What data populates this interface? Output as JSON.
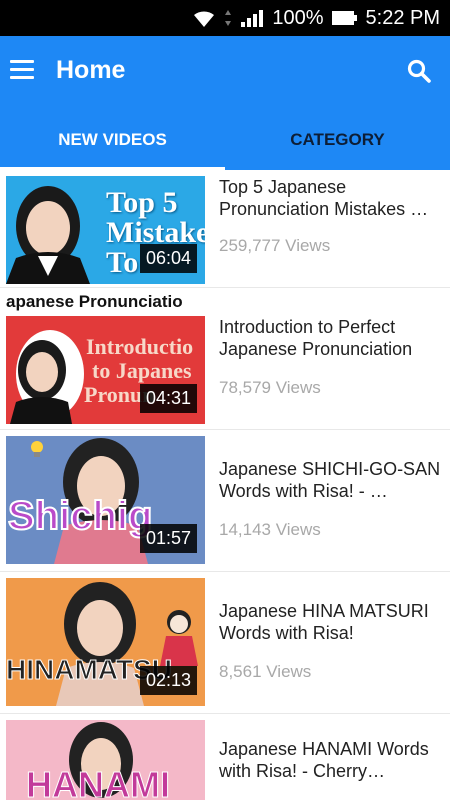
{
  "status": {
    "battery": "100%",
    "time": "5:22 PM"
  },
  "appbar": {
    "title": "Home"
  },
  "tabs": [
    {
      "label": "NEW VIDEOS"
    },
    {
      "label": "CATEGORY"
    }
  ],
  "videos": [
    {
      "title": "Top 5 Japanese Pronunciation Mistakes …",
      "views": "259,777 Views",
      "duration": "06:04",
      "thumb_text": "Top 5 Mistake To"
    },
    {
      "title": "Introduction to Perfect Japanese Pronunciation",
      "views": "78,579 Views",
      "duration": "04:31",
      "header_text": "apanese Pronunciatio",
      "thumb_line1": "Introductio",
      "thumb_line2": "to Japanes",
      "thumb_line3": "Pronun"
    },
    {
      "title": "Japanese SHICHI-GO-SAN Words with Risa! - …",
      "views": "14,143 Views",
      "duration": "01:57",
      "thumb_text": "Shichig"
    },
    {
      "title": "Japanese HINA MATSURI Words with Risa!",
      "views": "8,561 Views",
      "duration": "02:13",
      "thumb_text": "HINAMATSU"
    },
    {
      "title": "Japanese HANAMI Words with Risa! - Cherry…",
      "views": "",
      "duration": "",
      "thumb_text": "HANAMI"
    }
  ]
}
